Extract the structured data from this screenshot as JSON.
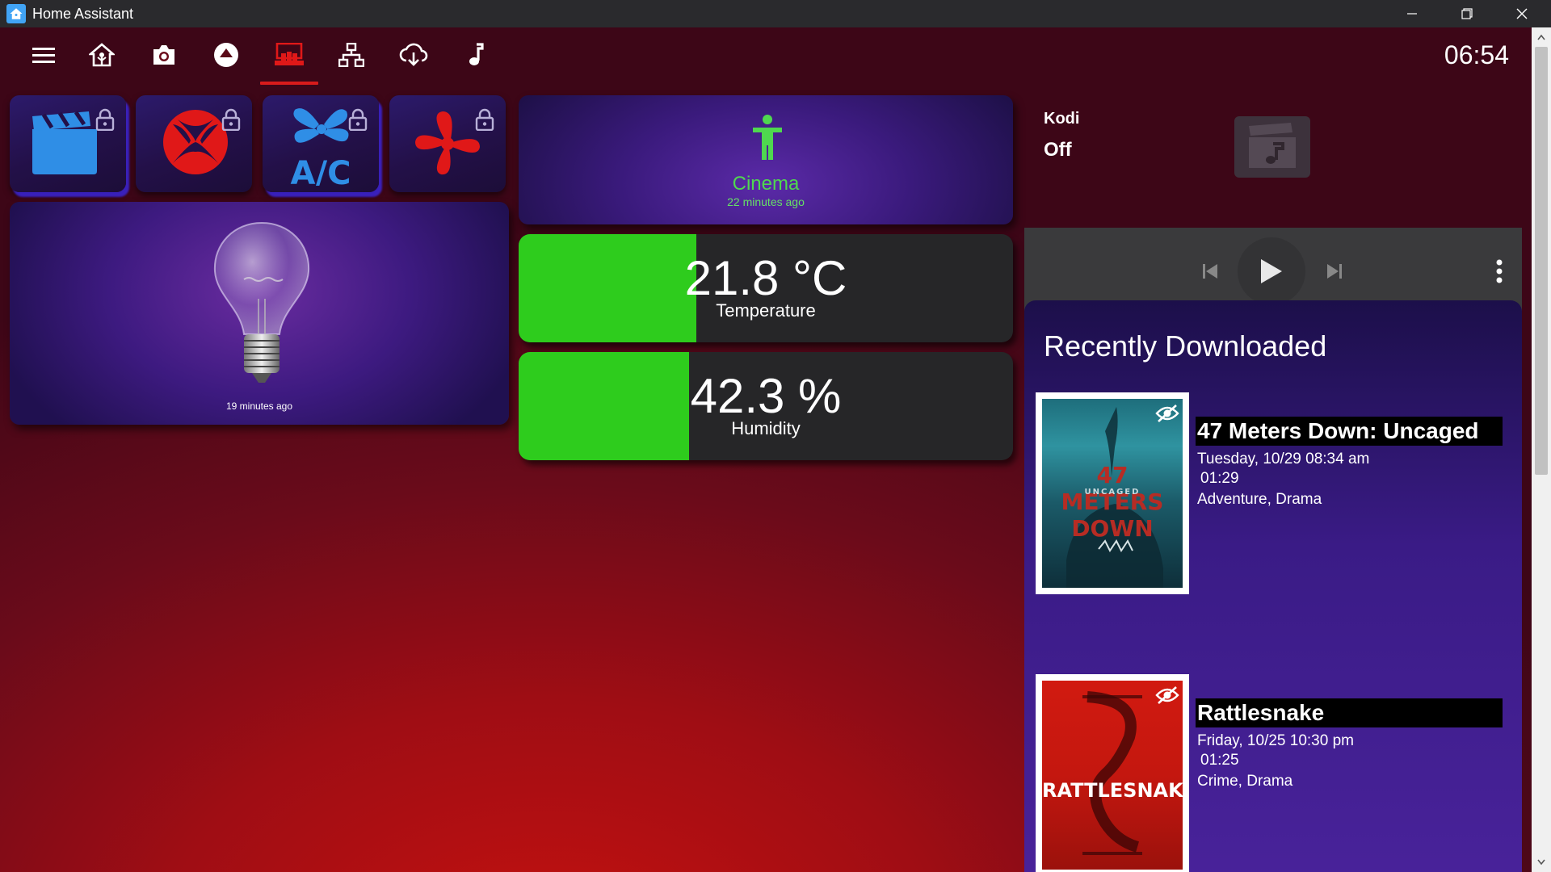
{
  "window": {
    "title": "Home Assistant",
    "controls": [
      "minimize-icon",
      "maximize-icon",
      "close-icon"
    ]
  },
  "toolbar": {
    "tabs": [
      {
        "id": "menu",
        "icon": "menu-icon"
      },
      {
        "id": "home",
        "icon": "home-icon"
      },
      {
        "id": "camera",
        "icon": "camera-icon"
      },
      {
        "id": "eject",
        "icon": "eject-icon"
      },
      {
        "id": "theater",
        "icon": "theater-icon",
        "active": true
      },
      {
        "id": "network",
        "icon": "network-icon"
      },
      {
        "id": "cloud",
        "icon": "cloud-download-icon"
      },
      {
        "id": "music",
        "icon": "music-note-icon"
      }
    ],
    "clock": "06:54",
    "active_color": "#d81b1b"
  },
  "tiles": [
    {
      "id": "movie",
      "icon": "movie-clapper-icon",
      "color": "#2f8ee6",
      "locked": true
    },
    {
      "id": "xbox",
      "icon": "xbox-icon",
      "color": "#e01818",
      "locked": true
    },
    {
      "id": "ac",
      "icon": "ac-fan-icon",
      "color": "#2f8ee6",
      "locked": true,
      "label": "A/C"
    },
    {
      "id": "fan",
      "icon": "fan-icon",
      "color": "#e01818",
      "locked": true
    }
  ],
  "light": {
    "icon": "light-bulb-icon",
    "last_changed": "19 minutes ago"
  },
  "cinema": {
    "icon": "person-icon",
    "name": "Cinema",
    "last_changed": "22 minutes ago",
    "color": "#4fd84f"
  },
  "sensors": [
    {
      "id": "temperature",
      "value": "21.8 °C",
      "label": "Temperature",
      "fill_fraction": 0.36
    },
    {
      "id": "humidity",
      "value": "42.3 %",
      "label": "Humidity",
      "fill_fraction": 0.345
    }
  ],
  "kodi": {
    "name": "Kodi",
    "state": "Off",
    "art_icon": "music-video-icon",
    "controls": [
      "skip-previous-icon",
      "play-icon",
      "skip-next-icon",
      "more-vertical-icon"
    ]
  },
  "recent": {
    "heading": "Recently Downloaded",
    "items": [
      {
        "title": "47 Meters Down: Uncaged",
        "date": "Tuesday, 10/29 08:34 am",
        "runtime": "01:29",
        "genres": "Adventure, Drama",
        "poster_text": "47 METERS DOWN",
        "poster_subtext": "UNCAGED",
        "poster_icon": "eye-off-icon"
      },
      {
        "title": "Rattlesnake",
        "date": "Friday, 10/25 10:30 pm",
        "runtime": "01:25",
        "genres": "Crime, Drama",
        "poster_text": "RATTLESNAKE",
        "poster_icon": "eye-off-icon"
      }
    ]
  }
}
